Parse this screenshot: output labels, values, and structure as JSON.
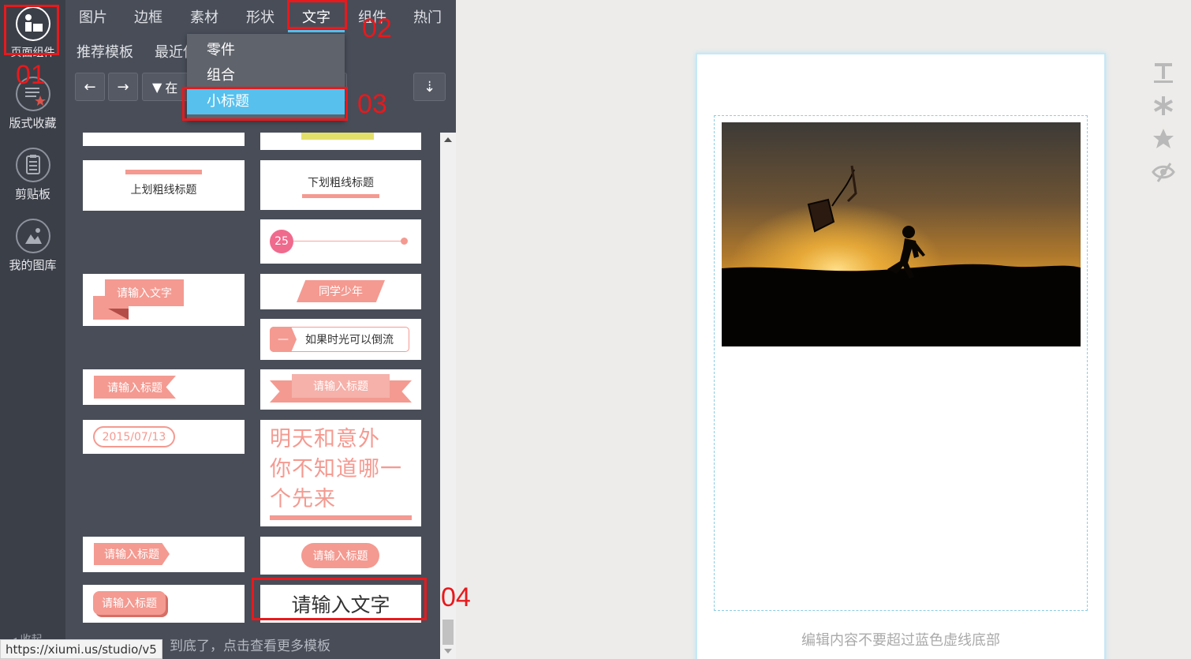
{
  "rail": {
    "items": [
      {
        "label": "页面组件"
      },
      {
        "label": "版式收藏"
      },
      {
        "label": "剪贴板"
      },
      {
        "label": "我的图库"
      }
    ],
    "collapse_label": "收起"
  },
  "tabs": [
    "图片",
    "边框",
    "素材",
    "形状",
    "文字",
    "组件",
    "热门"
  ],
  "subtabs": [
    "推荐模板",
    "最近使"
  ],
  "toolbar": {
    "back": "←",
    "forward": "→",
    "filter_label": "在",
    "sort": "⇣"
  },
  "dropdown": {
    "items": [
      "零件",
      "组合",
      "小标题"
    ],
    "selected": "小标题"
  },
  "cards": {
    "top_underline_title": "上划粗线标题",
    "bottom_underline_title": "下划粗线标题",
    "number_badge": "25",
    "ribbon_input_text": "请输入文字",
    "slant_title": "同学少年",
    "dash_badge": "—",
    "flow_text": "如果时光可以倒流",
    "arrow_title": "请输入标题",
    "banner_title": "请输入标题",
    "date_pill": "2015/07/13",
    "big_poem": [
      "明天和意外",
      "你不知道哪一",
      "个先来"
    ],
    "arrow_title_2": "请输入标题",
    "rounded_title": "请输入标题",
    "shadow_title": "请输入标题",
    "plain_text_box": "请输入文字"
  },
  "bottom_tip": "到底了，点击查看更多模板",
  "status_url": "https://xiumi.us/studio/v5",
  "annotations": [
    "01",
    "02",
    "03",
    "04"
  ],
  "canvas": {
    "footer_hint": "编辑内容不要超过蓝色虚线底部"
  },
  "colors": {
    "accent_blue": "#57c0ed",
    "pink": "#f49a91",
    "annotation_red": "#e8191c"
  }
}
